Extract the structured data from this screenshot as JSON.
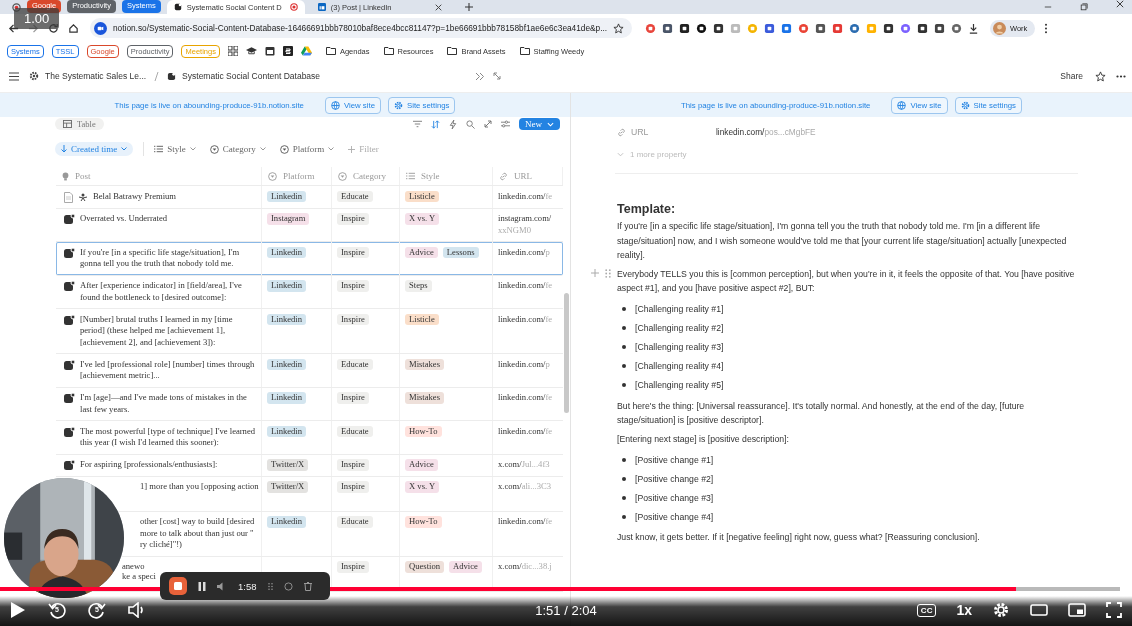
{
  "speed_badge": "1.00",
  "browser": {
    "tab_groups": [
      {
        "label": "Google",
        "color": "#d9482b"
      },
      {
        "label": "Productivity",
        "color": "#5f6368"
      },
      {
        "label": "Systems",
        "color": "#1a73e8"
      }
    ],
    "tabs": [
      {
        "title": "Systematic Social Content D",
        "selected": true,
        "recording": true
      },
      {
        "title": "(3) Post | LinkedIn",
        "selected": false,
        "recording": false
      }
    ],
    "url": "notion.so/Systematic-Social-Content-Database-16466691bbb78010baf8ece4bcc81147?p=1be66691bbb78158bf1ae6e6c3ea41de&p...",
    "profile": "Work",
    "bookmarks": [
      {
        "label": "Systems",
        "kind": "chip",
        "color": "#1a73e8"
      },
      {
        "label": "TSSL",
        "kind": "chip",
        "color": "#1a73e8"
      },
      {
        "label": "Google",
        "kind": "chip",
        "color": "#d9482b"
      },
      {
        "label": "Productivity",
        "kind": "chip",
        "color": "#5f6368"
      },
      {
        "label": "Meetings",
        "kind": "chip",
        "color": "#e8a400"
      },
      {
        "label": "Agendas",
        "kind": "folder"
      },
      {
        "label": "Resources",
        "kind": "folder"
      },
      {
        "label": "Brand Assets",
        "kind": "folder"
      },
      {
        "label": "Staffing Weedy",
        "kind": "folder"
      }
    ]
  },
  "notion": {
    "breadcrumbs": [
      "The Systematic Sales Le...",
      "Systematic Social Content Database"
    ],
    "share": "Share"
  },
  "left": {
    "banner": {
      "text": "This page is live on abounding-produce-91b.notion.site",
      "view": "View site",
      "settings": "Site settings"
    },
    "view": "Table",
    "new": "New",
    "filters": [
      {
        "label": "Created time",
        "kind": "sort"
      },
      {
        "label": "Style",
        "kind": "multi"
      },
      {
        "label": "Category",
        "kind": "select"
      },
      {
        "label": "Platform",
        "kind": "select"
      },
      {
        "label": "Filter",
        "kind": "add"
      }
    ],
    "columns": [
      {
        "label": "Post",
        "kind": "title"
      },
      {
        "label": "Platform",
        "kind": "select"
      },
      {
        "label": "Category",
        "kind": "select"
      },
      {
        "label": "Style",
        "kind": "multi"
      },
      {
        "label": "URL",
        "kind": "url"
      }
    ],
    "rows": [
      {
        "kind": "page",
        "post": "Belal Batrawy Premium",
        "selected": false,
        "platform": {
          "label": "Linkedin",
          "color": "#d3e5ef"
        },
        "category": {
          "label": "Educate",
          "color": "#efefed"
        },
        "styles": [
          {
            "label": "Listicle",
            "color": "#fadec9"
          }
        ],
        "url": {
          "domain": "linkedin.com/",
          "path": "fe"
        }
      },
      {
        "kind": "post",
        "post": "Overrated vs. Underrated",
        "selected": false,
        "platform": {
          "label": "Instagram",
          "color": "#f5e0e9"
        },
        "category": {
          "label": "Inspire",
          "color": "#efefed"
        },
        "styles": [
          {
            "label": "X vs. Y",
            "color": "#f5e0e9"
          }
        ],
        "url": {
          "domain": "instagram.com/",
          "path": "xxNGM0"
        }
      },
      {
        "kind": "post",
        "post": "If you're [in a specific life stage/situation], I'm gonna tell you the truth that nobody told me.",
        "selected": true,
        "platform": {
          "label": "Linkedin",
          "color": "#d3e5ef"
        },
        "category": {
          "label": "Inspire",
          "color": "#efefed"
        },
        "styles": [
          {
            "label": "Advice",
            "color": "#f5e0e9"
          },
          {
            "label": "Lessons",
            "color": "#d3e5ef"
          }
        ],
        "url": {
          "domain": "linkedin.com/",
          "path": "p"
        }
      },
      {
        "kind": "post",
        "post": "After [experience indicator] in [field/area], I've found the bottleneck to [desired outcome]:",
        "selected": false,
        "platform": {
          "label": "Linkedin",
          "color": "#d3e5ef"
        },
        "category": {
          "label": "Inspire",
          "color": "#efefed"
        },
        "styles": [
          {
            "label": "Steps",
            "color": "#efefed"
          }
        ],
        "url": {
          "domain": "linkedin.com/",
          "path": "fe"
        }
      },
      {
        "kind": "post",
        "post": "[Number] brutal truths I learned in my [time period] (these helped me [achievement 1], [achievement 2], and [achievement 3]):",
        "selected": false,
        "platform": {
          "label": "Linkedin",
          "color": "#d3e5ef"
        },
        "category": {
          "label": "Inspire",
          "color": "#efefed"
        },
        "styles": [
          {
            "label": "Listicle",
            "color": "#fadec9"
          }
        ],
        "url": {
          "domain": "linkedin.com/",
          "path": "fe"
        }
      },
      {
        "kind": "post",
        "post": "I've led [professional role] [number] times through [achievement metric]...",
        "selected": false,
        "platform": {
          "label": "Linkedin",
          "color": "#d3e5ef"
        },
        "category": {
          "label": "Educate",
          "color": "#efefed"
        },
        "styles": [
          {
            "label": "Mistakes",
            "color": "#eee0da"
          }
        ],
        "url": {
          "domain": "linkedin.com/",
          "path": "p"
        }
      },
      {
        "kind": "post",
        "post": "I'm [age]—and I've made tons of mistakes in the last few years.",
        "selected": false,
        "platform": {
          "label": "Linkedin",
          "color": "#d3e5ef"
        },
        "category": {
          "label": "Inspire",
          "color": "#efefed"
        },
        "styles": [
          {
            "label": "Mistakes",
            "color": "#eee0da"
          }
        ],
        "url": {
          "domain": "linkedin.com/",
          "path": "fe"
        }
      },
      {
        "kind": "post",
        "post": "The most powerful [type of technique] I've learned this year (I wish I'd learned this sooner):",
        "selected": false,
        "platform": {
          "label": "Linkedin",
          "color": "#d3e5ef"
        },
        "category": {
          "label": "Educate",
          "color": "#efefed"
        },
        "styles": [
          {
            "label": "How-To",
            "color": "#ffe2dd"
          }
        ],
        "url": {
          "domain": "linkedin.com/",
          "path": "fe"
        }
      },
      {
        "kind": "post",
        "post": "For aspiring [professionals/enthusiasts]:",
        "selected": false,
        "platform": {
          "label": "Twitter/X",
          "color": "#e3e2e0"
        },
        "category": {
          "label": "Inspire",
          "color": "#efefed"
        },
        "styles": [
          {
            "label": "Advice",
            "color": "#f5e0e9"
          }
        ],
        "url": {
          "domain": "x.com/",
          "path": "Jul...4f3"
        }
      },
      {
        "post_fragments": [
          "1] more than you [opposing action"
        ],
        "selected": false,
        "platform": {
          "label": "Twitter/X",
          "color": "#e3e2e0"
        },
        "category": {
          "label": "Inspire",
          "color": "#efefed"
        },
        "styles": [
          {
            "label": "X vs. Y",
            "color": "#f5e0e9"
          }
        ],
        "url": {
          "domain": "x.com/",
          "path": "ali...3C3"
        }
      },
      {
        "post_fragments": [
          "other [cost] way to build [desired",
          "more to talk about than just our \"",
          "ry cliché]\"!)"
        ],
        "selected": false,
        "platform": {
          "label": "Linkedin",
          "color": "#d3e5ef"
        },
        "category": {
          "label": "Educate",
          "color": "#efefed"
        },
        "styles": [
          {
            "label": "How-To",
            "color": "#ffe2dd"
          }
        ],
        "url": {
          "domain": "linkedin.com/",
          "path": "fe"
        }
      },
      {
        "post_fragments": [
          "anewo",
          "ke a speci"
        ],
        "selected": false,
        "category": {
          "label": "Inspire",
          "color": "#efefed"
        },
        "styles": [
          {
            "label": "Question",
            "color": "#eee0da"
          },
          {
            "label": "Advice",
            "color": "#f5e0e9"
          }
        ],
        "url": {
          "domain": "x.com/",
          "path": "dic...38.j"
        }
      }
    ]
  },
  "right": {
    "banner": {
      "text": "This page is live on abounding-produce-91b.notion.site",
      "view": "View site",
      "settings": "Site settings"
    },
    "property": {
      "label": "URL",
      "domain": "linkedin.com/",
      "path": "pos...cMgbFE"
    },
    "more": "1 more property",
    "blocks": [
      {
        "kind": "heading",
        "text": "Template:"
      },
      {
        "kind": "paragraph",
        "text": "If you're [in a specific life stage/situation], I'm gonna tell you the truth that nobody told me. I'm [in a different life stage/situation] now, and I wish someone would've told me that [your current life stage/situation] actually [unexpected reality].",
        "handle": false
      },
      {
        "kind": "paragraph",
        "text": "Everybody TELLS you this is [common perception], but when you're in it, it feels the opposite of that. You [have positive aspect #1], and you [have positive aspect #2], BUT:",
        "handle": true
      },
      {
        "kind": "bullets",
        "items": [
          "[Challenging reality #1]",
          "[Challenging reality #2]",
          "[Challenging reality #3]",
          "[Challenging reality #4]",
          "[Challenging reality #5]"
        ]
      },
      {
        "kind": "paragraph",
        "text": "But here's the thing: [Universal reassurance]. It's totally normal. And honestly, at the end of the day, [future stage/situation] is [positive descriptor].",
        "handle": false
      },
      {
        "kind": "paragraph",
        "text": "[Entering next stage] is [positive description]:",
        "handle": false
      },
      {
        "kind": "bullets",
        "items": [
          "[Positive change #1]",
          "[Positive change #2]",
          "[Positive change #3]",
          "[Positive change #4]"
        ]
      },
      {
        "kind": "paragraph",
        "text": "Just know, it gets better. If it [negative feeling] right now, guess what? [Reassuring conclusion].",
        "handle": false
      }
    ]
  },
  "recorder": {
    "time": "1:58"
  },
  "player": {
    "level": 0.907,
    "time": "1:51 / 2:04",
    "skip_back": "5",
    "skip_forward": "5",
    "captions": "CC",
    "speed": "1x"
  }
}
